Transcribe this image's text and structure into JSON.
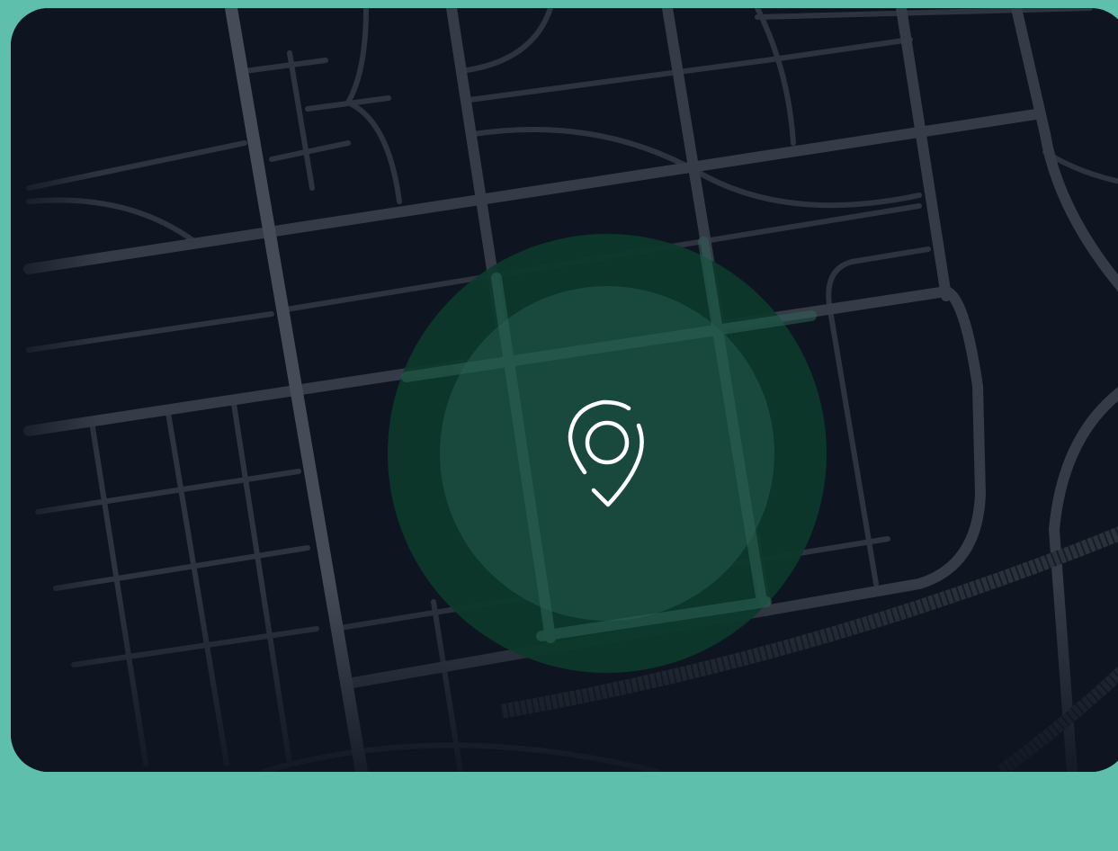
{
  "colors": {
    "page_background": "#5fbfad",
    "map_background": "#0e1520",
    "road": "#3a414c",
    "road_major": "#4a515b",
    "outer_circle": "#0b3a2a",
    "inner_circle": "#1a4b3e",
    "pin": "#ffffff"
  },
  "map": {
    "theme": "dark",
    "marker_icon": "location-pin-icon"
  }
}
